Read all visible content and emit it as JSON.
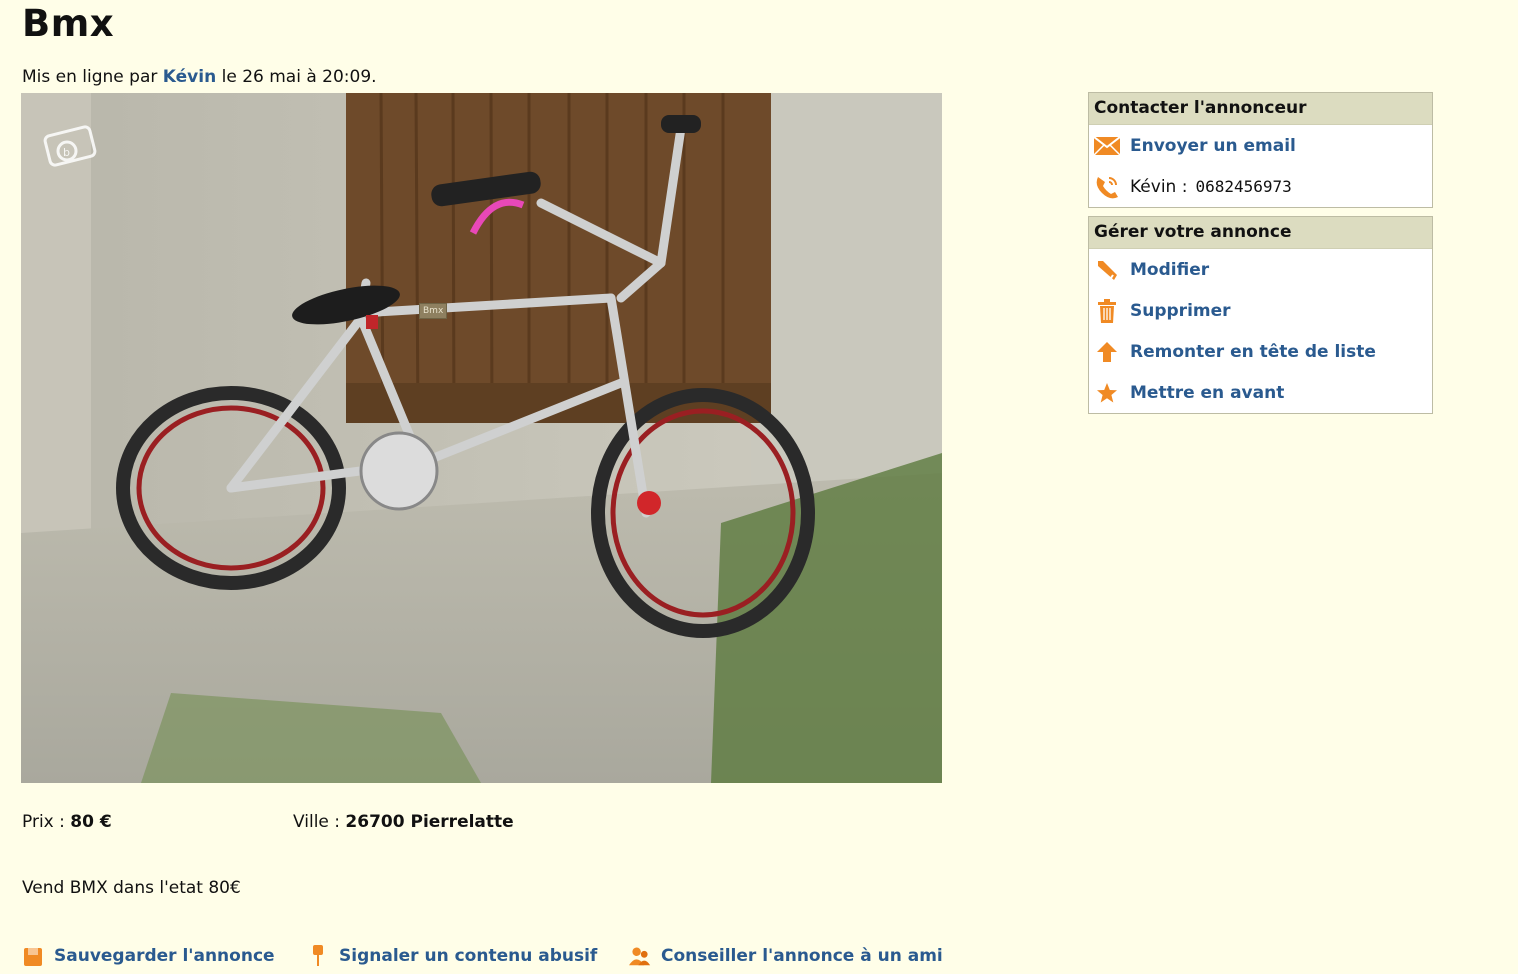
{
  "ad": {
    "title": "Bmx",
    "posted_prefix": "Mis en ligne par",
    "author": "Kévin",
    "posted_suffix": "le 26 mai à 20:09.",
    "photo_tag": "Bmx",
    "price_label": "Prix :",
    "price_value": "80 €",
    "city_label": "Ville :",
    "city_value": "26700 Pierrelatte",
    "description": "Vend BMX dans l'etat 80€"
  },
  "footer_actions": [
    {
      "label": "Sauvegarder l'annonce",
      "icon": "save-icon"
    },
    {
      "label": "Signaler un contenu abusif",
      "icon": "pin-icon"
    },
    {
      "label": "Conseiller l'annonce à un ami",
      "icon": "friends-icon"
    }
  ],
  "contact_box": {
    "header": "Contacter l'annonceur",
    "email_label": "Envoyer un email",
    "phone_name": "Kévin :",
    "phone_number": "0682456973"
  },
  "manage_box": {
    "header": "Gérer votre annonce",
    "items": [
      {
        "label": "Modifier",
        "icon": "pencil-icon"
      },
      {
        "label": "Supprimer",
        "icon": "trash-icon"
      },
      {
        "label": "Remonter en tête de liste",
        "icon": "arrow-up-icon"
      },
      {
        "label": "Mettre en avant",
        "icon": "star-icon"
      }
    ]
  },
  "colors": {
    "background": "#fffee8",
    "link": "#2a5a8f",
    "icon_orange": "#f08a24",
    "box_header": "#dcdcc0"
  }
}
